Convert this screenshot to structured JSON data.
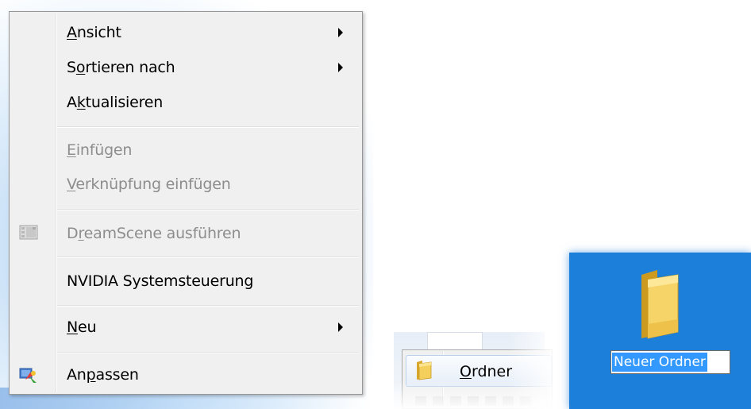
{
  "context_menu": {
    "items": [
      {
        "pre": "",
        "ul": "A",
        "post": "nsicht",
        "submenu": true,
        "disabled": false
      },
      {
        "pre": "S",
        "ul": "o",
        "post": "rtieren nach",
        "submenu": true,
        "disabled": false
      },
      {
        "pre": "A",
        "ul": "k",
        "post": "tualisieren",
        "submenu": false,
        "disabled": false
      },
      {
        "pre": "",
        "ul": "E",
        "post": "infügen",
        "submenu": false,
        "disabled": true
      },
      {
        "pre": "",
        "ul": "V",
        "post": "erknüpfung einfügen",
        "submenu": false,
        "disabled": true
      },
      {
        "pre": "D",
        "ul": "r",
        "post": "eamScene ausführen",
        "submenu": false,
        "disabled": true,
        "icon": "dreamscene-icon"
      },
      {
        "pre": "NVIDIA Systemsteuerung",
        "ul": "",
        "post": "",
        "submenu": false,
        "disabled": false
      },
      {
        "pre": "",
        "ul": "N",
        "post": "eu",
        "submenu": true,
        "disabled": false
      },
      {
        "pre": "An",
        "ul": "p",
        "post": "assen",
        "submenu": false,
        "disabled": false,
        "icon": "personalize-icon"
      }
    ]
  },
  "new_submenu": {
    "item": {
      "pre": "",
      "ul": "O",
      "post": "rdner",
      "icon": "folder-icon"
    }
  },
  "desktop": {
    "folder_icon": "folder-icon",
    "rename_value": "Neuer Ordner"
  },
  "colors": {
    "menu_bg": "#f0f0f0",
    "desktop_blue": "#1c7fd9",
    "selection": "#3399ff",
    "disabled_text": "#8d8d8d"
  }
}
